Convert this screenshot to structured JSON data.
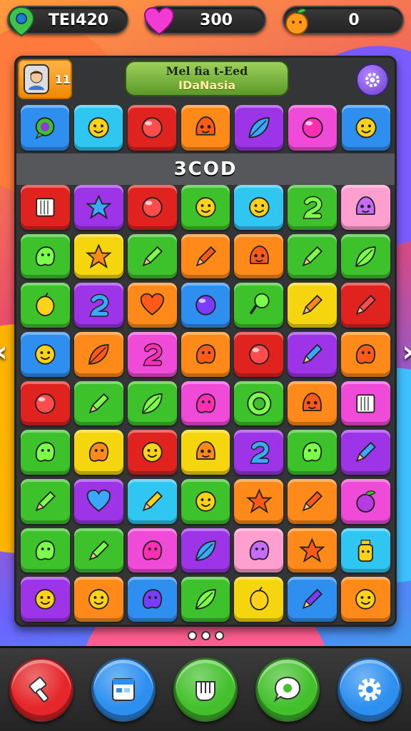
{
  "hud": {
    "gems": {
      "value": "TEI420",
      "icon": "location-pin-icon"
    },
    "lives": {
      "value": "300",
      "icon": "heart-icon"
    },
    "fruit": {
      "value": "0",
      "icon": "orange-fruit-icon"
    }
  },
  "board": {
    "level_badge": "11",
    "title_line1": "Mel fia t-Eed",
    "title_line2": "IDaNasia",
    "score_banner": "3COD"
  },
  "colors": {
    "red": "#e0231f",
    "blue": "#2f8ff0",
    "cyan": "#2fc6f2",
    "green": "#3ec22b",
    "purple": "#9d34e8",
    "pink": "#f04ad8",
    "orange": "#ff8a1a",
    "yellow": "#f5d60e",
    "lightpink": "#ff9fd0"
  },
  "top_row": [
    {
      "color": "blue",
      "icon": "bubble-icon"
    },
    {
      "color": "cyan",
      "icon": "smile-face-icon"
    },
    {
      "color": "red",
      "icon": "ball-icon"
    },
    {
      "color": "orange",
      "icon": "face-icon"
    },
    {
      "color": "purple",
      "icon": "leaf-icon"
    },
    {
      "color": "pink",
      "icon": "ball-icon"
    },
    {
      "color": "blue",
      "icon": "smile-face-icon"
    }
  ],
  "grid": [
    [
      {
        "color": "red",
        "icon": "book-icon"
      },
      {
        "color": "purple",
        "icon": "star-icon"
      },
      {
        "color": "red",
        "icon": "ball-icon"
      },
      {
        "color": "green",
        "icon": "smile-face-icon"
      },
      {
        "color": "cyan",
        "icon": "smile-face-icon"
      },
      {
        "color": "green",
        "icon": "swirl-icon"
      },
      {
        "color": "lightpink",
        "icon": "face-icon"
      }
    ],
    [
      {
        "color": "green",
        "icon": "blob-icon"
      },
      {
        "color": "yellow",
        "icon": "star-icon"
      },
      {
        "color": "green",
        "icon": "pencil-icon"
      },
      {
        "color": "orange",
        "icon": "pencil-icon"
      },
      {
        "color": "orange",
        "icon": "face-icon"
      },
      {
        "color": "green",
        "icon": "pencil-icon"
      },
      {
        "color": "green",
        "icon": "leaf-icon"
      }
    ],
    [
      {
        "color": "green",
        "icon": "lemon-icon"
      },
      {
        "color": "purple",
        "icon": "swirl-icon"
      },
      {
        "color": "orange",
        "icon": "heart-icon"
      },
      {
        "color": "blue",
        "icon": "ball-icon"
      },
      {
        "color": "green",
        "icon": "pin-icon"
      },
      {
        "color": "yellow",
        "icon": "pencil-icon"
      },
      {
        "color": "red",
        "icon": "pencil-icon"
      }
    ],
    [
      {
        "color": "blue",
        "icon": "smile-face-icon"
      },
      {
        "color": "orange",
        "icon": "leaf-icon"
      },
      {
        "color": "pink",
        "icon": "swirl-icon"
      },
      {
        "color": "orange",
        "icon": "blob-icon"
      },
      {
        "color": "red",
        "icon": "ball-icon"
      },
      {
        "color": "purple",
        "icon": "pencil-icon"
      },
      {
        "color": "orange",
        "icon": "blob-icon"
      }
    ],
    [
      {
        "color": "red",
        "icon": "ball-icon"
      },
      {
        "color": "green",
        "icon": "pencil-icon"
      },
      {
        "color": "green",
        "icon": "leaf-icon"
      },
      {
        "color": "pink",
        "icon": "blob-icon"
      },
      {
        "color": "green",
        "icon": "ring-icon"
      },
      {
        "color": "orange",
        "icon": "face-icon"
      },
      {
        "color": "pink",
        "icon": "book-icon"
      }
    ],
    [
      {
        "color": "green",
        "icon": "blob-icon"
      },
      {
        "color": "yellow",
        "icon": "blob-icon"
      },
      {
        "color": "red",
        "icon": "smile-face-icon"
      },
      {
        "color": "yellow",
        "icon": "face-icon"
      },
      {
        "color": "purple",
        "icon": "swirl-icon"
      },
      {
        "color": "green",
        "icon": "blob-icon"
      },
      {
        "color": "purple",
        "icon": "pencil-icon"
      }
    ],
    [
      {
        "color": "green",
        "icon": "pencil-icon"
      },
      {
        "color": "purple",
        "icon": "heart-icon"
      },
      {
        "color": "cyan",
        "icon": "pencil-icon"
      },
      {
        "color": "green",
        "icon": "smile-face-icon"
      },
      {
        "color": "orange",
        "icon": "star-icon"
      },
      {
        "color": "orange",
        "icon": "pencil-icon"
      },
      {
        "color": "pink",
        "icon": "fruit-icon"
      }
    ],
    [
      {
        "color": "green",
        "icon": "blob-icon"
      },
      {
        "color": "green",
        "icon": "pencil-icon"
      },
      {
        "color": "pink",
        "icon": "blob-icon"
      },
      {
        "color": "purple",
        "icon": "leaf-icon"
      },
      {
        "color": "lightpink",
        "icon": "blob-icon"
      },
      {
        "color": "orange",
        "icon": "star-icon"
      },
      {
        "color": "cyan",
        "icon": "bottle-icon"
      }
    ],
    [
      {
        "color": "purple",
        "icon": "smile-face-icon"
      },
      {
        "color": "orange",
        "icon": "smile-face-icon"
      },
      {
        "color": "blue",
        "icon": "blob-icon"
      },
      {
        "color": "green",
        "icon": "leaf-icon"
      },
      {
        "color": "yellow",
        "icon": "lemon-icon"
      },
      {
        "color": "blue",
        "icon": "pencil-icon"
      },
      {
        "color": "orange",
        "icon": "smile-face-icon"
      }
    ]
  ],
  "bottom_buttons": [
    {
      "name": "hammer-button",
      "color": "#e5262a",
      "icon": "hammer-icon"
    },
    {
      "name": "calendar-button",
      "color": "#2d8ff0",
      "icon": "calendar-icon"
    },
    {
      "name": "pause-button",
      "color": "#43c02c",
      "icon": "hand-icon"
    },
    {
      "name": "chat-button",
      "color": "#43c02c",
      "icon": "chat-bubble-icon"
    },
    {
      "name": "settings-button",
      "color": "#2d8ff0",
      "icon": "gear-icon"
    }
  ]
}
